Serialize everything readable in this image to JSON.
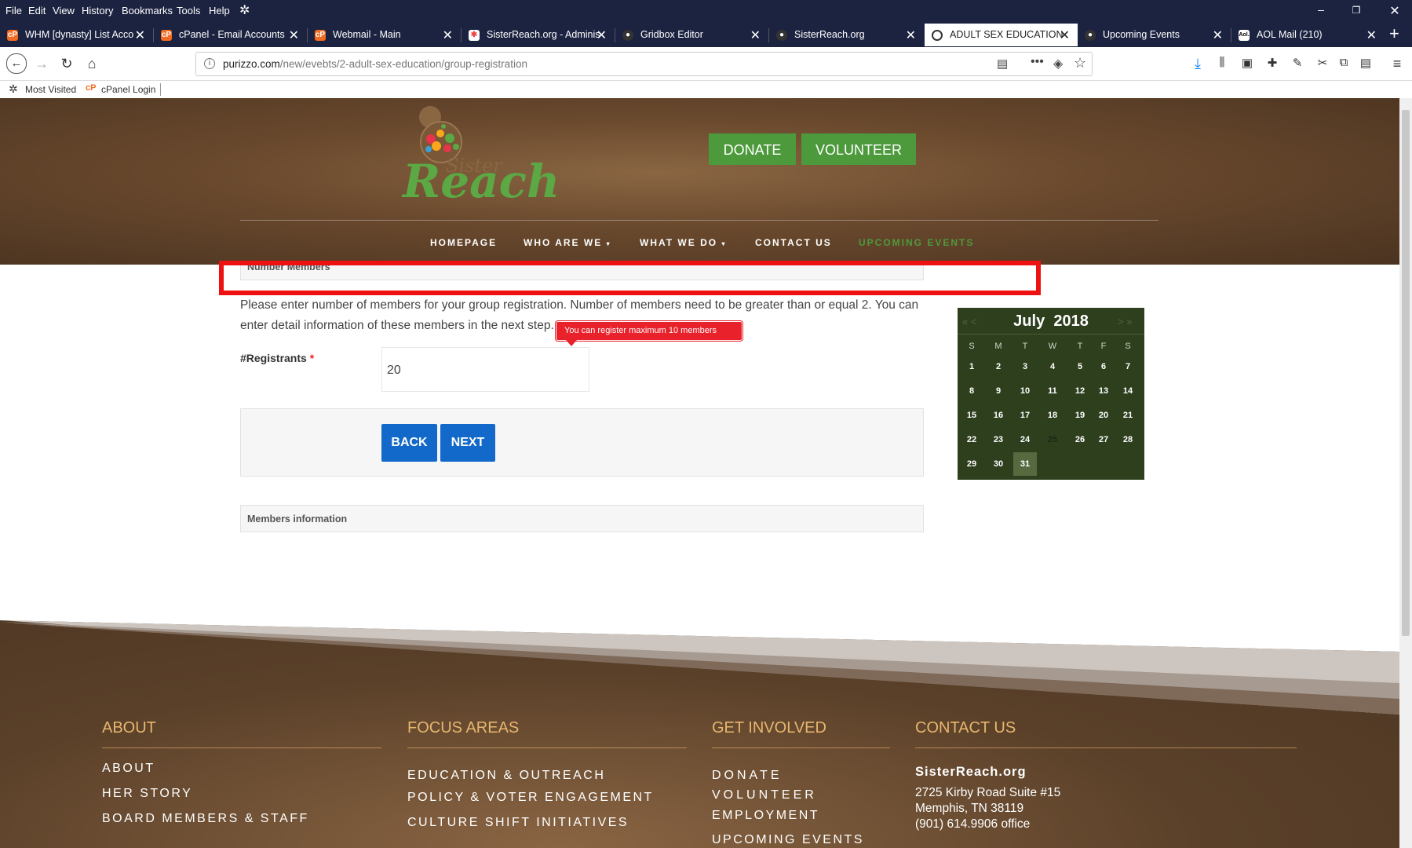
{
  "menubar": {
    "items": [
      "File",
      "Edit",
      "View",
      "History",
      "Bookmarks",
      "Tools",
      "Help"
    ]
  },
  "tabs": [
    {
      "label": "WHM [dynasty] List Acco",
      "icon": "cpanel-icon"
    },
    {
      "label": "cPanel - Email Accounts",
      "icon": "cpanel-icon"
    },
    {
      "label": "Webmail - Main",
      "icon": "cpanel-icon"
    },
    {
      "label": "SisterReach.org - Adminis",
      "icon": "joomla-icon"
    },
    {
      "label": "Gridbox Editor",
      "icon": "gridbox-icon"
    },
    {
      "label": "SisterReach.org",
      "icon": "site-icon"
    },
    {
      "label": "ADULT SEX EDUCATION",
      "icon": "site-icon"
    },
    {
      "label": "Upcoming Events",
      "icon": "site-icon"
    },
    {
      "label": "AOL Mail (210)",
      "icon": "aol-icon"
    }
  ],
  "urlbar": {
    "domain": "purizzo.com",
    "path": "/new/evebts/2-adult-sex-education/group-registration"
  },
  "bookmarks": [
    {
      "label": "Most Visited"
    },
    {
      "label": "cPanel Login"
    }
  ],
  "site": {
    "logo_main": "Reach",
    "logo_sub": "Sister",
    "header_buttons": {
      "donate": "DONATE",
      "volunteer": "VOLUNTEER"
    },
    "nav": [
      "HOMEPAGE",
      "WHO ARE WE",
      "WHAT WE DO",
      "CONTACT US",
      "UPCOMING EVENTS"
    ],
    "accent": "#4d9a3c"
  },
  "form": {
    "section_title": "Number Members",
    "description": "Please enter number of members for your group registration. Number of members need to be greater than or equal 2. You can enter detail information of these members in the next step.",
    "tooltip": "You can register maximum 10 members",
    "registrants_label": "#Registrants",
    "required_mark": "*",
    "registrants_value": "20",
    "back_label": "BACK",
    "next_label": "NEXT",
    "members_section_title": "Members information"
  },
  "calendar": {
    "month": "July",
    "year": "2018",
    "prev": "«  <",
    "next": ">  »",
    "day_names": [
      "S",
      "M",
      "T",
      "W",
      "T",
      "F",
      "S"
    ],
    "weeks": [
      [
        "1",
        "2",
        "3",
        "4",
        "5",
        "6",
        "7"
      ],
      [
        "8",
        "9",
        "10",
        "11",
        "12",
        "13",
        "14"
      ],
      [
        "15",
        "16",
        "17",
        "18",
        "19",
        "20",
        "21"
      ],
      [
        "22",
        "23",
        "24",
        "25",
        "26",
        "27",
        "28"
      ],
      [
        "29",
        "30",
        "31",
        "",
        "",
        "",
        ""
      ]
    ],
    "selected": "31",
    "dim": "25"
  },
  "footer": {
    "about": {
      "heading": "ABOUT",
      "links": [
        "ABOUT",
        "HER STORY",
        "BOARD MEMBERS & STAFF"
      ]
    },
    "focus": {
      "heading": "FOCUS AREAS",
      "links": [
        "EDUCATION & OUTREACH",
        "POLICY & VOTER ENGAGEMENT",
        "CULTURE SHIFT INITIATIVES"
      ]
    },
    "involved": {
      "heading": "GET INVOLVED",
      "links": [
        "DONATE",
        "VOLUNTEER",
        "EMPLOYMENT",
        "UPCOMING EVENTS"
      ]
    },
    "contact": {
      "heading": "CONTACT US",
      "org": "SisterReach.org",
      "address1": "2725 Kirby Road Suite #15",
      "address2": "Memphis, TN 38119",
      "phone": "(901) 614.9906 office"
    }
  }
}
